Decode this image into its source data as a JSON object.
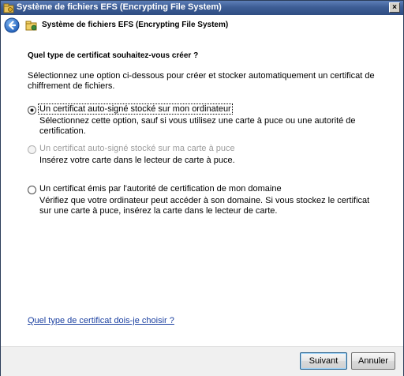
{
  "window": {
    "title": "Système de fichiers EFS (Encrypting File System)",
    "close_glyph": "×"
  },
  "header": {
    "title": "Système de fichiers EFS (Encrypting File System)"
  },
  "content": {
    "question": "Quel type de certificat souhaitez-vous créer ?",
    "intro": "Sélectionnez une option ci-dessous pour créer et stocker automatiquement un certificat de chiffrement de fichiers.",
    "options": [
      {
        "label": "Un certificat auto-signé stocké sur mon ordinateur",
        "description": "Sélectionnez cette option, sauf si vous utilisez une carte à puce ou une autorité de certification.",
        "selected": true,
        "enabled": true
      },
      {
        "label": "Un certificat auto-signé stocké sur ma carte à puce",
        "description": "Insérez votre carte dans le lecteur de carte à puce.",
        "selected": false,
        "enabled": false
      },
      {
        "label": "Un certificat émis par l'autorité de certification de mon domaine",
        "description": "Vérifiez que votre ordinateur peut accéder à son domaine. Si vous stockez le certificat sur une carte à puce, insérez la carte dans le lecteur de carte.",
        "selected": false,
        "enabled": true
      }
    ],
    "help_link": "Quel type de certificat dois-je choisir ?"
  },
  "footer": {
    "next_label": "Suivant",
    "cancel_label": "Annuler"
  }
}
